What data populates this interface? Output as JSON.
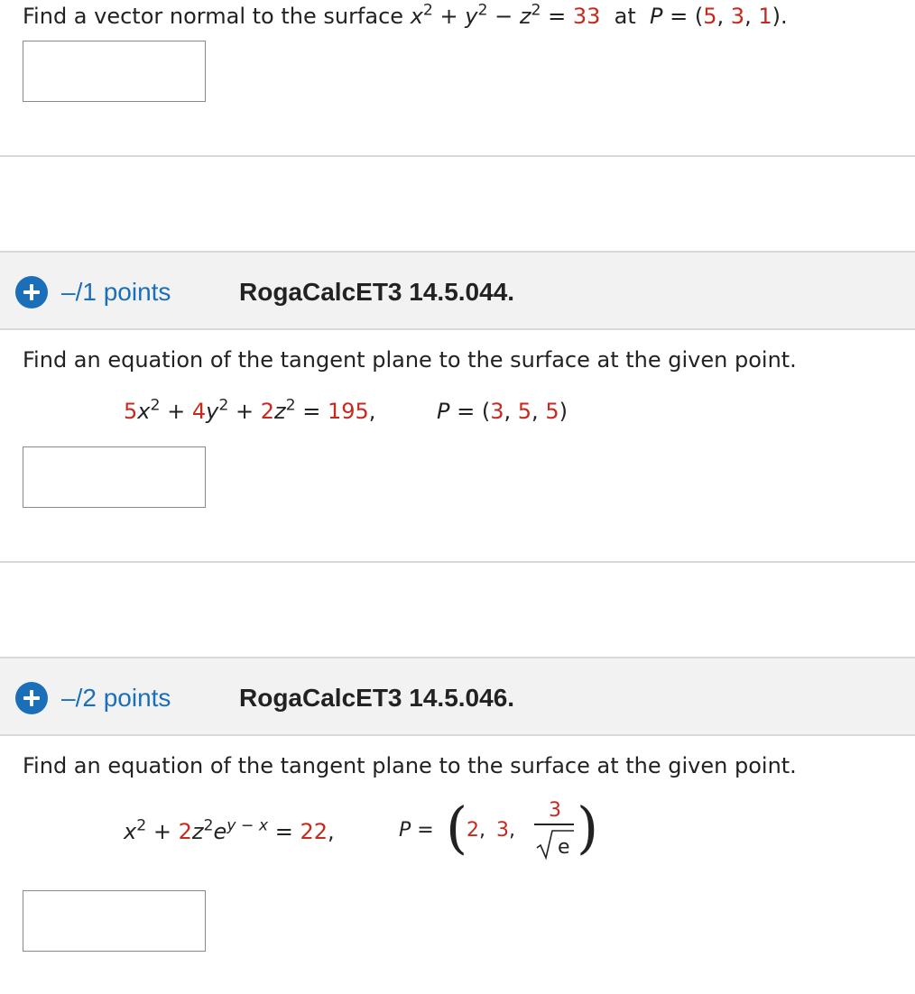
{
  "q0": {
    "text_prefix": "Find a vector normal to the surface ",
    "eq_x": "x",
    "eq_x_exp": "2",
    "eq_plus1": " + ",
    "eq_y": "y",
    "eq_y_exp": "2",
    "eq_minus": " − ",
    "eq_z": "z",
    "eq_z_exp": "2",
    "eq_equals": " = ",
    "eq_rhs": "33",
    "at_word": "  at  ",
    "p_label": "P",
    "p_equals": " = (",
    "p1": "5",
    "sep1": ", ",
    "p2": "3",
    "sep2": ", ",
    "p3": "1",
    "p_close": ")."
  },
  "q1": {
    "points_label": "–/1 points",
    "question_id": "RogaCalcET3 14.5.044.",
    "prompt": "Find an equation of the tangent plane to the surface at the given point.",
    "c1": "5",
    "v1": "x",
    "e1": "2",
    "plus1": " + ",
    "c2": "4",
    "v2": "y",
    "e2": "2",
    "plus2": " + ",
    "c3": "2",
    "v3": "z",
    "e3": "2",
    "equals": " = ",
    "rhs": "195",
    "comma": ",",
    "p_label": "P",
    "p_equals": " = (",
    "p1": "3",
    "sep1": ", ",
    "p2": "5",
    "sep2": ", ",
    "p3": "5",
    "p_close": ")"
  },
  "q2": {
    "points_label": "–/2 points",
    "question_id": "RogaCalcET3 14.5.046.",
    "prompt": "Find an equation of the tangent plane to the surface at the given point.",
    "v1": "x",
    "e1": "2",
    "plus": " + ",
    "c2": "2",
    "v2": "z",
    "e2": "2",
    "e_base": "e",
    "e_exp": "y − x",
    "equals": " = ",
    "rhs": "22",
    "comma": ",",
    "p_label": "P",
    "p_equals": " =",
    "p1": "2",
    "sep1": ",",
    "p2": "3",
    "sep2": ",",
    "frac_num": "3",
    "frac_den": "e",
    "paren_open": "(",
    "paren_close": ")"
  },
  "colors": {
    "accent": "#1a6fb8",
    "highlight": "#c62a1f",
    "header_bg": "#f2f2f2"
  },
  "icons": {
    "expand": "plus-circle-icon"
  }
}
